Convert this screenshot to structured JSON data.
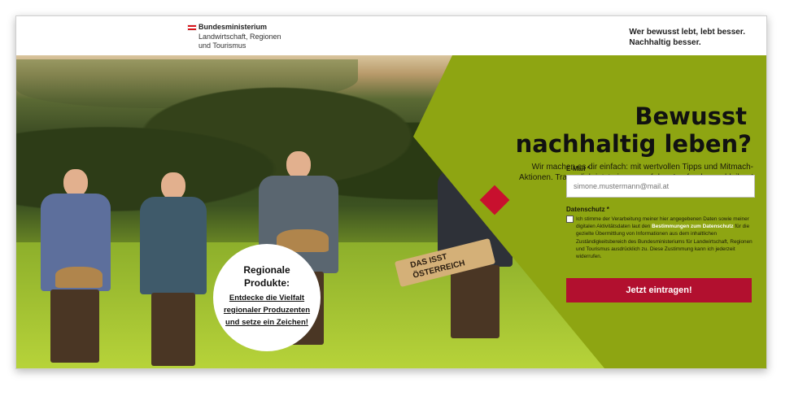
{
  "header": {
    "logo_line1": "Bundesministerium",
    "logo_line2": "Landwirtschaft, Regionen",
    "logo_line3": "und Tourismus",
    "tagline_line1": "Wer bewusst lebt, lebt besser.",
    "tagline_line2": "Nachhaltig besser."
  },
  "hero": {
    "headline_line1": "Bewusst",
    "headline_line2": "nachhaltig leben?",
    "subtitle": "Wir machen es dir einfach: mit wertvollen Tipps und Mitmach-Aktionen. Trage dich jetzt ein, um auf dem Laufenden zu bleiben!",
    "sign_line1": "DAS ISST",
    "sign_line2": "ÖSTERREICH"
  },
  "promo": {
    "title_line1": "Regionale",
    "title_line2": "Produkte:",
    "link_line1": "Entdecke die Vielfalt",
    "link_line2": "regionaler Produzenten",
    "link_line3": "und setze ein Zeichen!"
  },
  "form": {
    "email_label": "E-Mail *",
    "email_placeholder": "simone.mustermann@mail.at",
    "privacy_label": "Datenschutz *",
    "privacy_text_before": "Ich stimme der Verarbeitung meiner hier angegebenen Daten sowie meiner digitalen Aktivitätsdaten laut den ",
    "privacy_link": "Bestimmungen zum Datenschutz",
    "privacy_text_after": " für die gezielte Übermittlung von Informationen aus dem inhaltlichen Zuständigkeitsbereich des Bundesministeriums für Landwirtschaft, Regionen und Tourismus ausdrücklich zu. Diese Zustimmung kann ich jederzeit widerrufen.",
    "privacy_checked": false,
    "submit_label": "Jetzt eintragen!"
  },
  "colors": {
    "accent_green": "#8ea512",
    "submit_red": "#b2102f"
  }
}
